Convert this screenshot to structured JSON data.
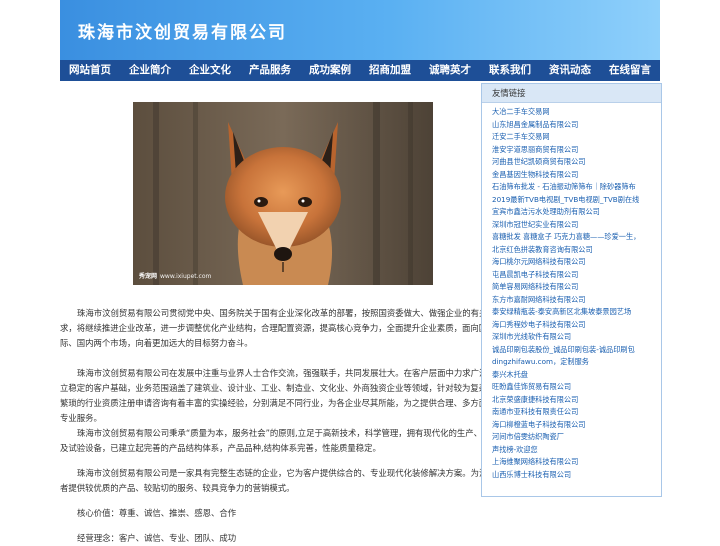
{
  "header": {
    "title": "珠海市汶创贸易有限公司"
  },
  "nav": [
    "网站首页",
    "企业简介",
    "企业文化",
    "产品服务",
    "成功案例",
    "招商加盟",
    "诚聘英才",
    "联系我们",
    "资讯动态",
    "在线留言"
  ],
  "photo": {
    "watermark_logo": "秀宠网",
    "watermark_url": "www.ixiupet.com"
  },
  "paragraphs": [
    "珠海市汶创贸易有限公司贯彻党中央、国务院关于国有企业深化改革的部署，按照国资委做大、做强企业的有关要求，将继续推进企业改革，进一步调整优化产业结构，合理配置资源，提高核心竞争力，全面提升企业素质，面向国际、国内两个市场，向着更加远大的目标努力奋斗。",
    "珠海市汶创贸易有限公司在发展中注重与业界人士合作交流，强强联手，共同发展壮大。在客户层面中力求广泛建立稳定的客户基础，业务范围涵盖了建筑业、设计业、工业、制造业、文化业、外商独资企业等领域，针对较为复杂、繁琐的行业资质注册申请咨询有着丰富的实操经验，分别满足不同行业，为各企业尽其所能，为之提供合理、多方面的专业服务。",
    "珠海市汶创贸易有限公司秉承“质量为本，服务社会”的原则,立足于高新技术，科学管理，拥有现代化的生产、检测及试验设备，已建立起完善的产品结构体系，产品品种,结构体系完善，性能质量稳定。",
    "珠海市汶创贸易有限公司是一家具有完整生态链的企业，它为客户提供综合的、专业现代化装修解决方案。为消费者提供较优质的产品、较贴切的服务、较具竞争力的营销模式。",
    "核心价值：尊重、诚信、推崇、感恩、合作",
    "经营理念：客户、诚信、专业、团队、成功"
  ],
  "sidebar": {
    "title": "友情链接",
    "links": [
      "大冶二手车交易网",
      "山东旭昌金属制品有限公司",
      "迁安二手车交易网",
      "淮安宇道思丽商贸有限公司",
      "河曲县世纪凯硕商贸有限公司",
      "金昌基因生物科技有限公司",
      "石油筛布批发 - 石油振动筛筛布｜除砂器筛布",
      "2019最新TVB电视剧_TVB电视剧_TVB剧在线",
      "宜宾市鑫洁污水处理助剂有限公司",
      "深圳市冠世纪实业有限公司",
      "喜糖批发 喜糖盒子 巧克力喜糖——珍爱一生，",
      "北京红色拼装教育咨询有限公司",
      "海口桃尔元网络科技有限公司",
      "屯昌晨凯电子科技有限公司",
      "简单容易网络科技有限公司",
      "东方市嘉耐网络科技有限公司",
      "泰安绿精瓶装-泰安高新区北集坡泰景园艺场",
      "海口秀程妙电子科技有限公司",
      "深圳市光线软件有限公司",
      "诚品印刷包装股份_诚品印刷包装-诚品印刷包",
      "dingzhifawu.com，定制服务",
      "泰兴木托盘",
      "旺盼鑫佳饰贸易有限公司",
      "北京荣盛康捷科技有限公司",
      "南通市亚科技有限责任公司",
      "海口柳橙蓝电子科技有限公司",
      "河间市倍雯纺织陶瓷厂",
      "声找榜-欢迎您",
      "上海维聚网络科技有限公司",
      "山西乐博士科技有限公司"
    ]
  }
}
